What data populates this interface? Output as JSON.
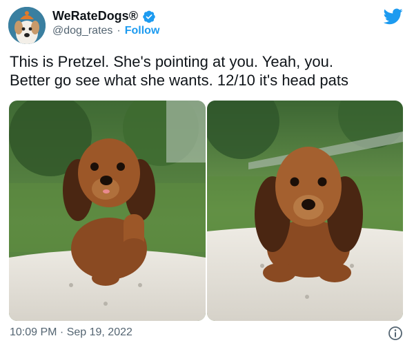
{
  "header": {
    "display_name": "WeRateDogs®",
    "handle": "@dog_rates",
    "separator": "·",
    "follow_label": "Follow"
  },
  "tweet": {
    "lines": [
      "This is Pretzel. She's pointing at you. Yeah, you.",
      "Better go see what she wants. 12/10 it's head pats"
    ]
  },
  "media": {
    "count": 2
  },
  "footer": {
    "timestamp": "10:09 PM · Sep 19, 2022"
  },
  "colors": {
    "accent": "#1d9bf0",
    "text": "#0f1419",
    "secondary": "#536471"
  },
  "icons": [
    "verified-badge-icon",
    "twitter-bird-icon",
    "info-icon"
  ]
}
